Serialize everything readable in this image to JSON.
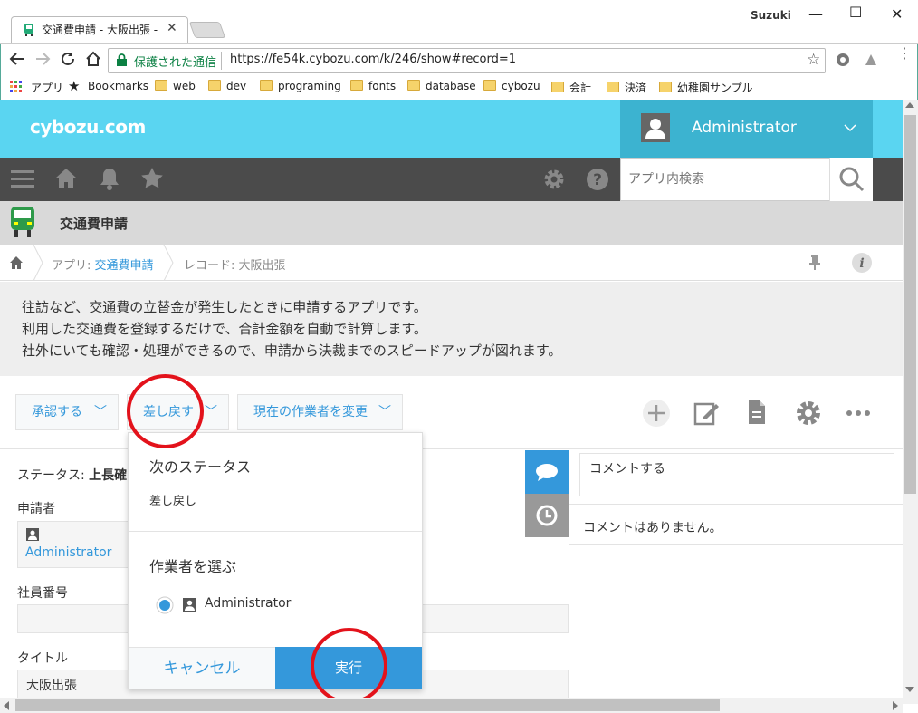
{
  "browser": {
    "tab_title": "交通費申請 - 大阪出張 -",
    "profile_name": "Suzuki",
    "security_label": "保護された通信",
    "url": "https://fe54k.cybozu.com/k/246/show#record=1",
    "bookmarks": [
      "アプリ",
      "Bookmarks",
      "web",
      "dev",
      "programing",
      "fonts",
      "database",
      "cybozu",
      "会計",
      "決済",
      "幼稚園サンプル"
    ]
  },
  "header": {
    "logo": "cybozu.com",
    "user": "Administrator",
    "search_placeholder": "アプリ内検索"
  },
  "app": {
    "title": "交通費申請",
    "breadcrumb_app_prefix": "アプリ:",
    "breadcrumb_app": "交通費申請",
    "breadcrumb_record": "レコード: 大阪出張",
    "description": [
      "往訪など、交通費の立替金が発生したときに申請するアプリです。",
      "利用した交通費を登録するだけで、合計金額を自動で計算します。",
      "社外にいても確認・処理ができるので、申請から決裁までのスピードアップが図れます。"
    ]
  },
  "actions": {
    "approve": "承認する",
    "sendback": "差し戻す",
    "change_assignee": "現在の作業者を変更"
  },
  "form": {
    "status_label": "ステータス:",
    "status_value": "上長確",
    "applicant_label": "申請者",
    "applicant_value": "Administrator",
    "employee_no_label": "社員番号",
    "employee_no_value": "",
    "title_label": "タイトル",
    "title_value": "大阪出張"
  },
  "comments": {
    "placeholder": "コメントする",
    "empty": "コメントはありません。"
  },
  "popup": {
    "next_status_heading": "次のステータス",
    "next_status_value": "差し戻し",
    "assignee_heading": "作業者を選ぶ",
    "assignee_option": "Administrator",
    "cancel": "キャンセル",
    "execute": "実行"
  },
  "colors": {
    "accent": "#3498db",
    "header": "#5ad5f1",
    "highlight_circle": "#e3121b"
  }
}
